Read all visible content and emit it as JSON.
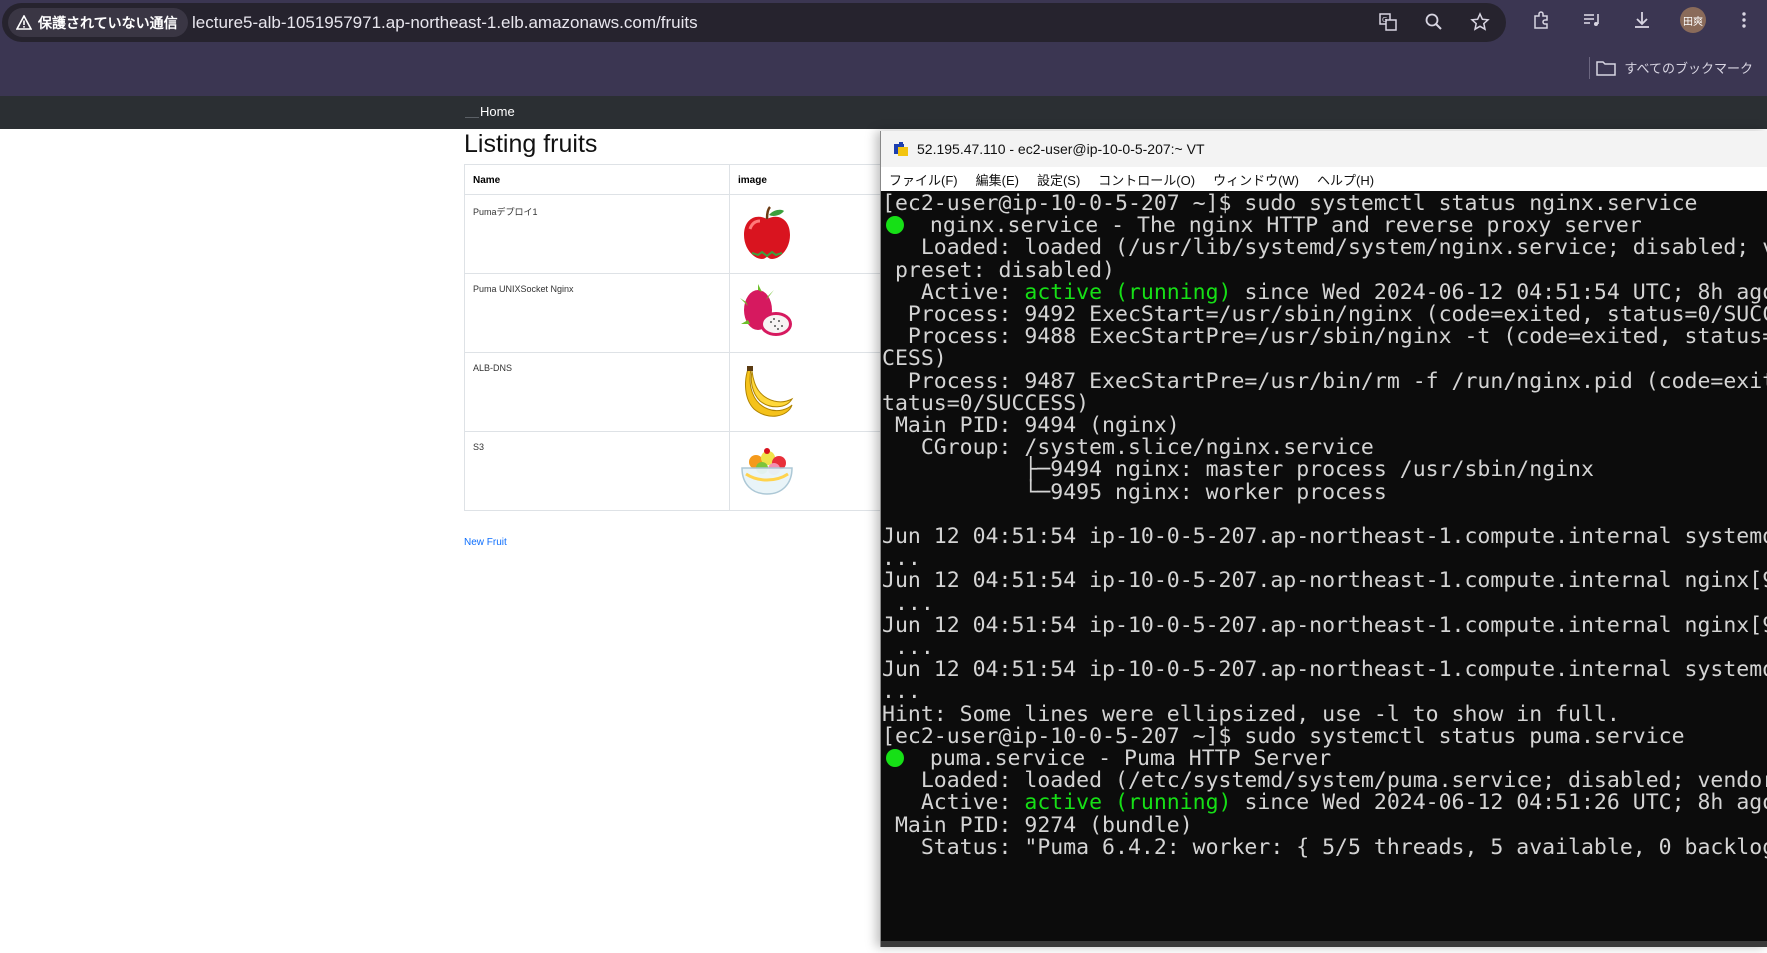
{
  "browser": {
    "security_label": "保護されていない通信",
    "url": "lecture5-alb-1051957971.ap-northeast-1.elb.amazonaws.com/fruits",
    "bookmarks_label": "すべてのブックマーク",
    "avatar_text": "田爽"
  },
  "site": {
    "nav_home": "Home",
    "title": "Listing fruits",
    "table": {
      "headers": [
        "Name",
        "image"
      ],
      "rows": [
        {
          "name": "Pumaデプロイ1",
          "image": "apple"
        },
        {
          "name": "Puma UNIXSocket Nginx",
          "image": "dragon-fruit"
        },
        {
          "name": "ALB-DNS",
          "image": "banana"
        },
        {
          "name": "S3",
          "image": "fruit-bowl"
        }
      ]
    },
    "new_fruit_link": "New Fruit"
  },
  "terminal": {
    "title": "52.195.47.110 - ec2-user@ip-10-0-5-207:~ VT",
    "menu": [
      "ファイル(F)",
      "編集(E)",
      "設定(S)",
      "コントロール(O)",
      "ウィンドウ(W)",
      "ヘルプ(H)"
    ],
    "lines": [
      "[ec2-user@ip-10-0-5-207 ~]$ sudo systemctl status nginx.service",
      "  nginx.service - The nginx HTTP and reverse proxy server",
      "   Loaded: loaded (/usr/lib/systemd/system/nginx.service; disabled; v",
      " preset: disabled)",
      "   Active: ",
      "active (running)",
      " since Wed 2024-06-12 04:51:54 UTC; 8h ago",
      "  Process: 9492 ExecStart=/usr/sbin/nginx (code=exited, status=0/SUCC",
      "  Process: 9488 ExecStartPre=/usr/sbin/nginx -t (code=exited, status=",
      "CESS)",
      "  Process: 9487 ExecStartPre=/usr/bin/rm -f /run/nginx.pid (code=exit",
      "tatus=0/SUCCESS)",
      " Main PID: 9494 (nginx)",
      "   CGroup: /system.slice/nginx.service",
      "           ├─9494 nginx: master process /usr/sbin/nginx",
      "           └─9495 nginx: worker process",
      "",
      "Jun 12 04:51:54 ip-10-0-5-207.ap-northeast-1.compute.internal systemd",
      "...",
      "Jun 12 04:51:54 ip-10-0-5-207.ap-northeast-1.compute.internal nginx[9",
      " ...",
      "Jun 12 04:51:54 ip-10-0-5-207.ap-northeast-1.compute.internal nginx[9",
      " ...",
      "Jun 12 04:51:54 ip-10-0-5-207.ap-northeast-1.compute.internal systemd",
      "...",
      "Hint: Some lines were ellipsized, use -l to show in full.",
      "[ec2-user@ip-10-0-5-207 ~]$ sudo systemctl status puma.service",
      "  puma.service - Puma HTTP Server",
      "   Loaded: loaded (/etc/systemd/system/puma.service; disabled; vendor",
      "   Active: ",
      "active (running)",
      " since Wed 2024-06-12 04:51:26 UTC; 8h ago",
      " Main PID: 9274 (bundle)",
      "   Status: \"Puma 6.4.2: worker: { 5/5 threads, 5 available, 0 backlog"
    ]
  },
  "colors": {
    "chrome_bg": "#3b3652",
    "navbar_bg": "#2b2f33",
    "terminal_bg": "#0c0c0c",
    "status_green": "#16e016",
    "link_blue": "#0d6efd"
  }
}
